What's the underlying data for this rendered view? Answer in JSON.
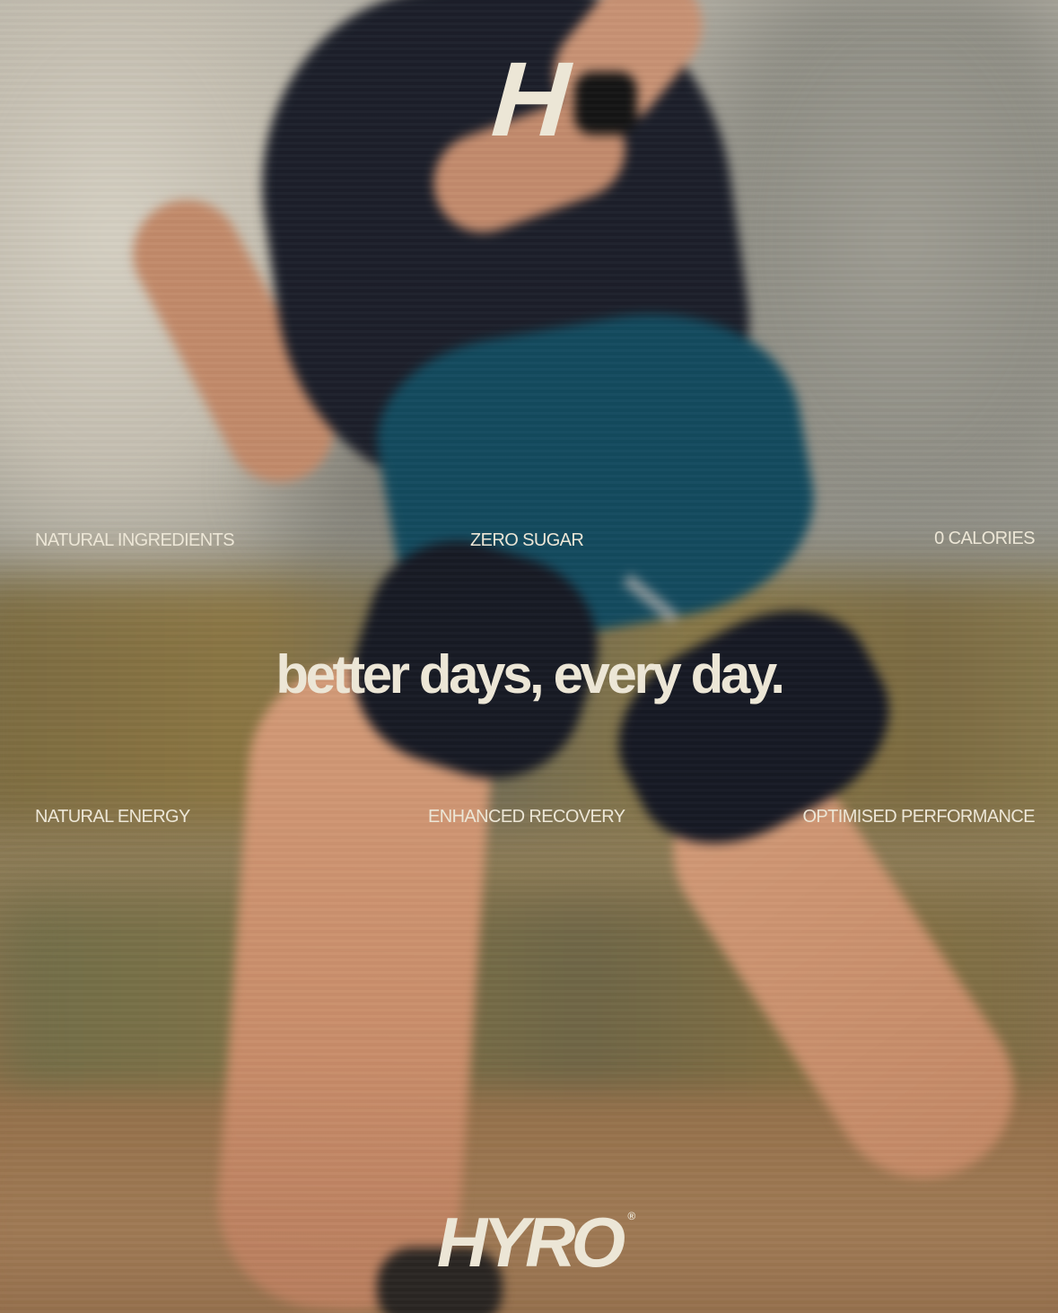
{
  "brand": {
    "mark": "H",
    "wordmark": "HYRO",
    "registered": "®",
    "text_color": "#ece6d6"
  },
  "tagline": "better days, every day.",
  "claims": {
    "top": [
      "NATURAL INGREDIENTS",
      "ZERO SUGAR",
      "0 CALORIES"
    ],
    "bottom": [
      "NATURAL ENERGY",
      "ENHANCED RECOVERY",
      "OPTIMISED PERFORMANCE"
    ]
  },
  "photo": {
    "subject": "runner-in-motion",
    "colors": {
      "shirt": "#1c1f2a",
      "shorts": "#134a5e",
      "skin": "#c98d6a",
      "rock": "#b9b5aa",
      "ground": "#9b7550"
    }
  }
}
